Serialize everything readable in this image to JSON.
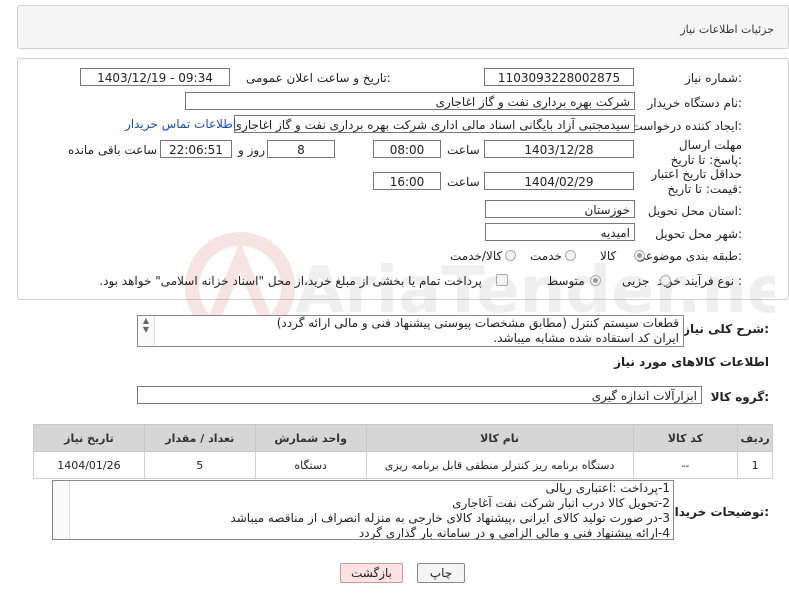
{
  "header": {
    "title": "جزئیات اطلاعات نیاز"
  },
  "form": {
    "need_number_label": "شماره نیاز:",
    "need_number": "1103093228002875",
    "announce_label": "تاریخ و ساعت اعلان عمومی:",
    "announce_value": "1403/12/19 - 09:34",
    "buyer_org_label": "نام دستگاه خریدار:",
    "buyer_org": "شرکت بهره برداری نفت و گاز اغاجاری",
    "creator_label": "ایجاد کننده درخواست:",
    "creator": "سیدمجتبی آزاد بایگانی اسناد مالی اداری شرکت بهره برداری نفت و گاز اغاجاری",
    "contact_link": "اطلاعات تماس خریدار",
    "deadline_label": "مهلت ارسال پاسخ: تا تاریخ:",
    "deadline_date": "1403/12/28",
    "time_label": "ساعت",
    "deadline_time": "08:00",
    "days_value": "8",
    "days_and_label": "روز و",
    "remaining_time": "22:06:51",
    "remaining_label": "ساعت باقی مانده",
    "price_validity_label": "حداقل تاریخ اعتبار قیمت: تا تاریخ:",
    "price_validity_date": "1404/02/29",
    "price_validity_time": "16:00",
    "province_label": "استان محل تحویل:",
    "province": "خوزستان",
    "city_label": "شهر محل تحویل:",
    "city": "امیدیه",
    "category_label": "طبقه بندی موضوعی:",
    "category_options": [
      "کالا",
      "خدمت",
      "کالا/خدمت"
    ],
    "purchase_type_label": "نوع فرآیند خرید :",
    "purchase_options": [
      "جزیی",
      "متوسط"
    ],
    "payment_note": "پرداخت تمام یا بخشی از مبلغ خرید،از محل \"اسناد خزانه اسلامی\" خواهد بود."
  },
  "description": {
    "label": "شرح کلی نیاز:",
    "line1": "قطعات سیستم کنترل (مطابق مشخصات پیوستی پیشنهاد فنی و مالی ارائه گردد)",
    "line2": "ایران کد استفاده شده مشابه میباشد."
  },
  "goods": {
    "section_title": "اطلاعات کالاهای مورد نیاز",
    "group_label": "گروه کالا:",
    "group_value": "ابزارآلات اندازه گیری",
    "columns": [
      "ردیف",
      "کد کالا",
      "نام کالا",
      "واحد شمارش",
      "تعداد / مقدار",
      "تاریخ نیاز"
    ],
    "rows": [
      [
        "1",
        "--",
        "دستگاه برنامه ریز کنترلر منطقی قابل برنامه ریزی",
        "دستگاه",
        "5",
        "1404/01/26"
      ]
    ]
  },
  "buyer_notes": {
    "label": "توضیحات خریدار:",
    "lines": [
      "1-پرداخت :اعتباری ریالی",
      "2-تحویل کالا درب انبار شرکت نفت آغاجاری",
      "3-در صورت تولید کالای ایرانی ،پیشنهاد کالای خارجی به منزله انصراف از مناقصه میباشد",
      "4-ارائه پیشنهاد فنی و مالی الزامی و در سامانه بار گذاری گردد"
    ]
  },
  "buttons": {
    "print": "چاپ",
    "back": "بازگشت"
  },
  "watermark": {
    "text": "AriaTender.net"
  },
  "colors": {
    "link": "#1a4fb3",
    "back_button_bg": "#fbe3e3",
    "table_header": "#d6d6d6"
  }
}
